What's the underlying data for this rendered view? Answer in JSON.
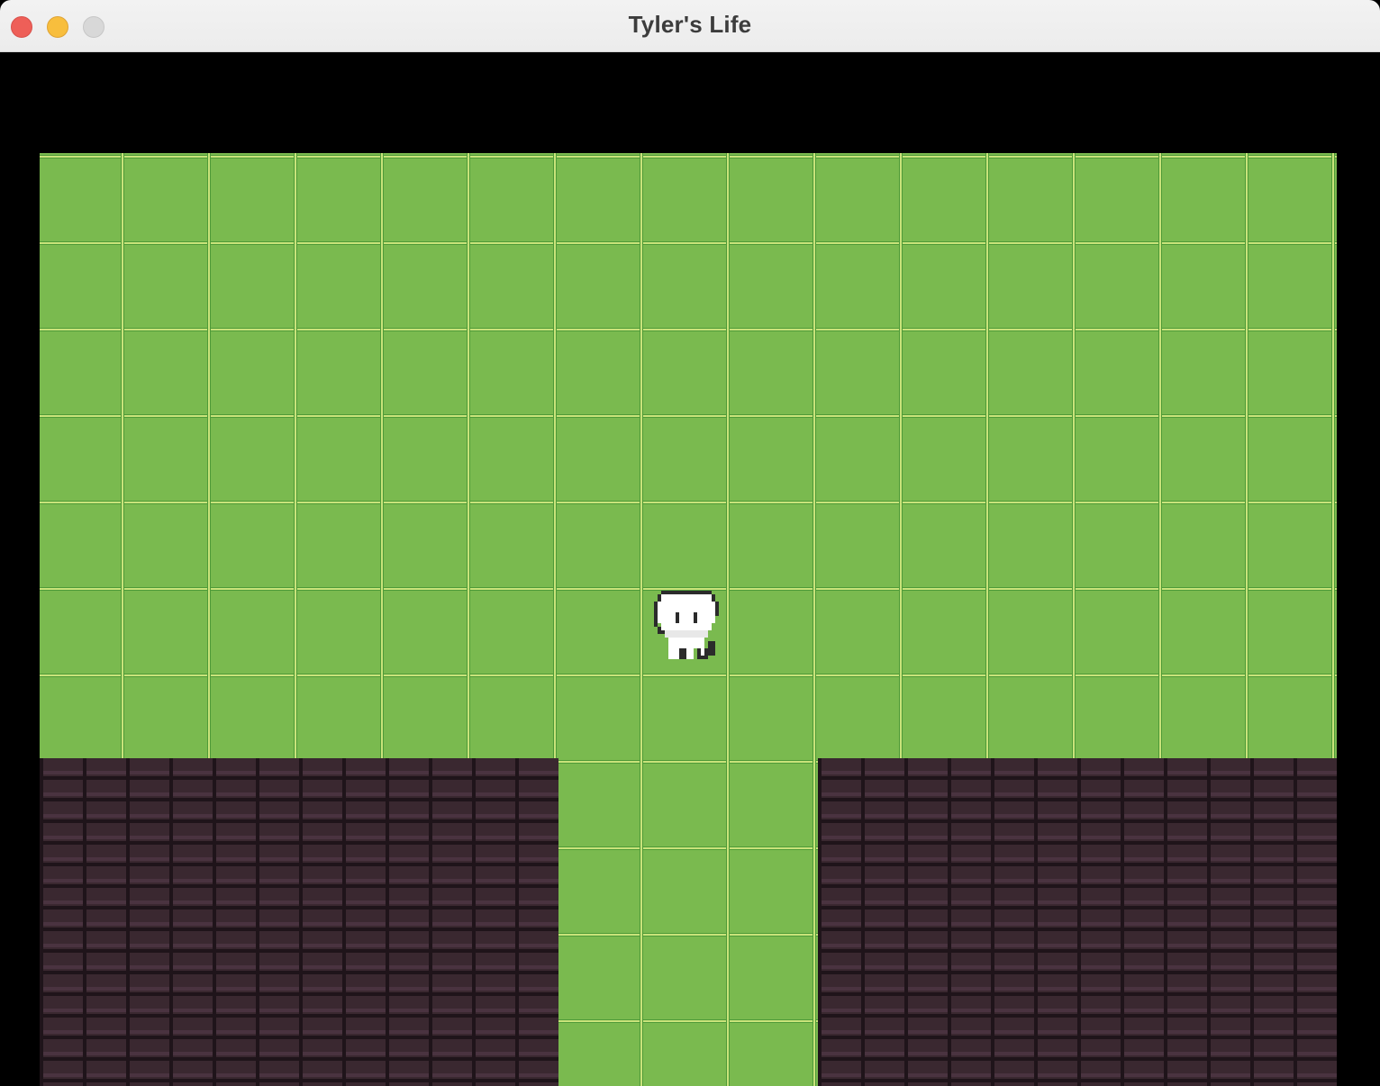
{
  "window": {
    "title": "Tyler's Life"
  },
  "colors": {
    "grass": "#7aba4f",
    "grass_light": "#c9e37a",
    "grass_dark": "#4e9a38",
    "brick": "#3a2830",
    "brick_mortar": "#1f141a",
    "background": "#000000"
  },
  "icons": {
    "close": "close-icon",
    "minimize": "minimize-icon",
    "zoom": "zoom-icon",
    "player": "player-sprite"
  }
}
